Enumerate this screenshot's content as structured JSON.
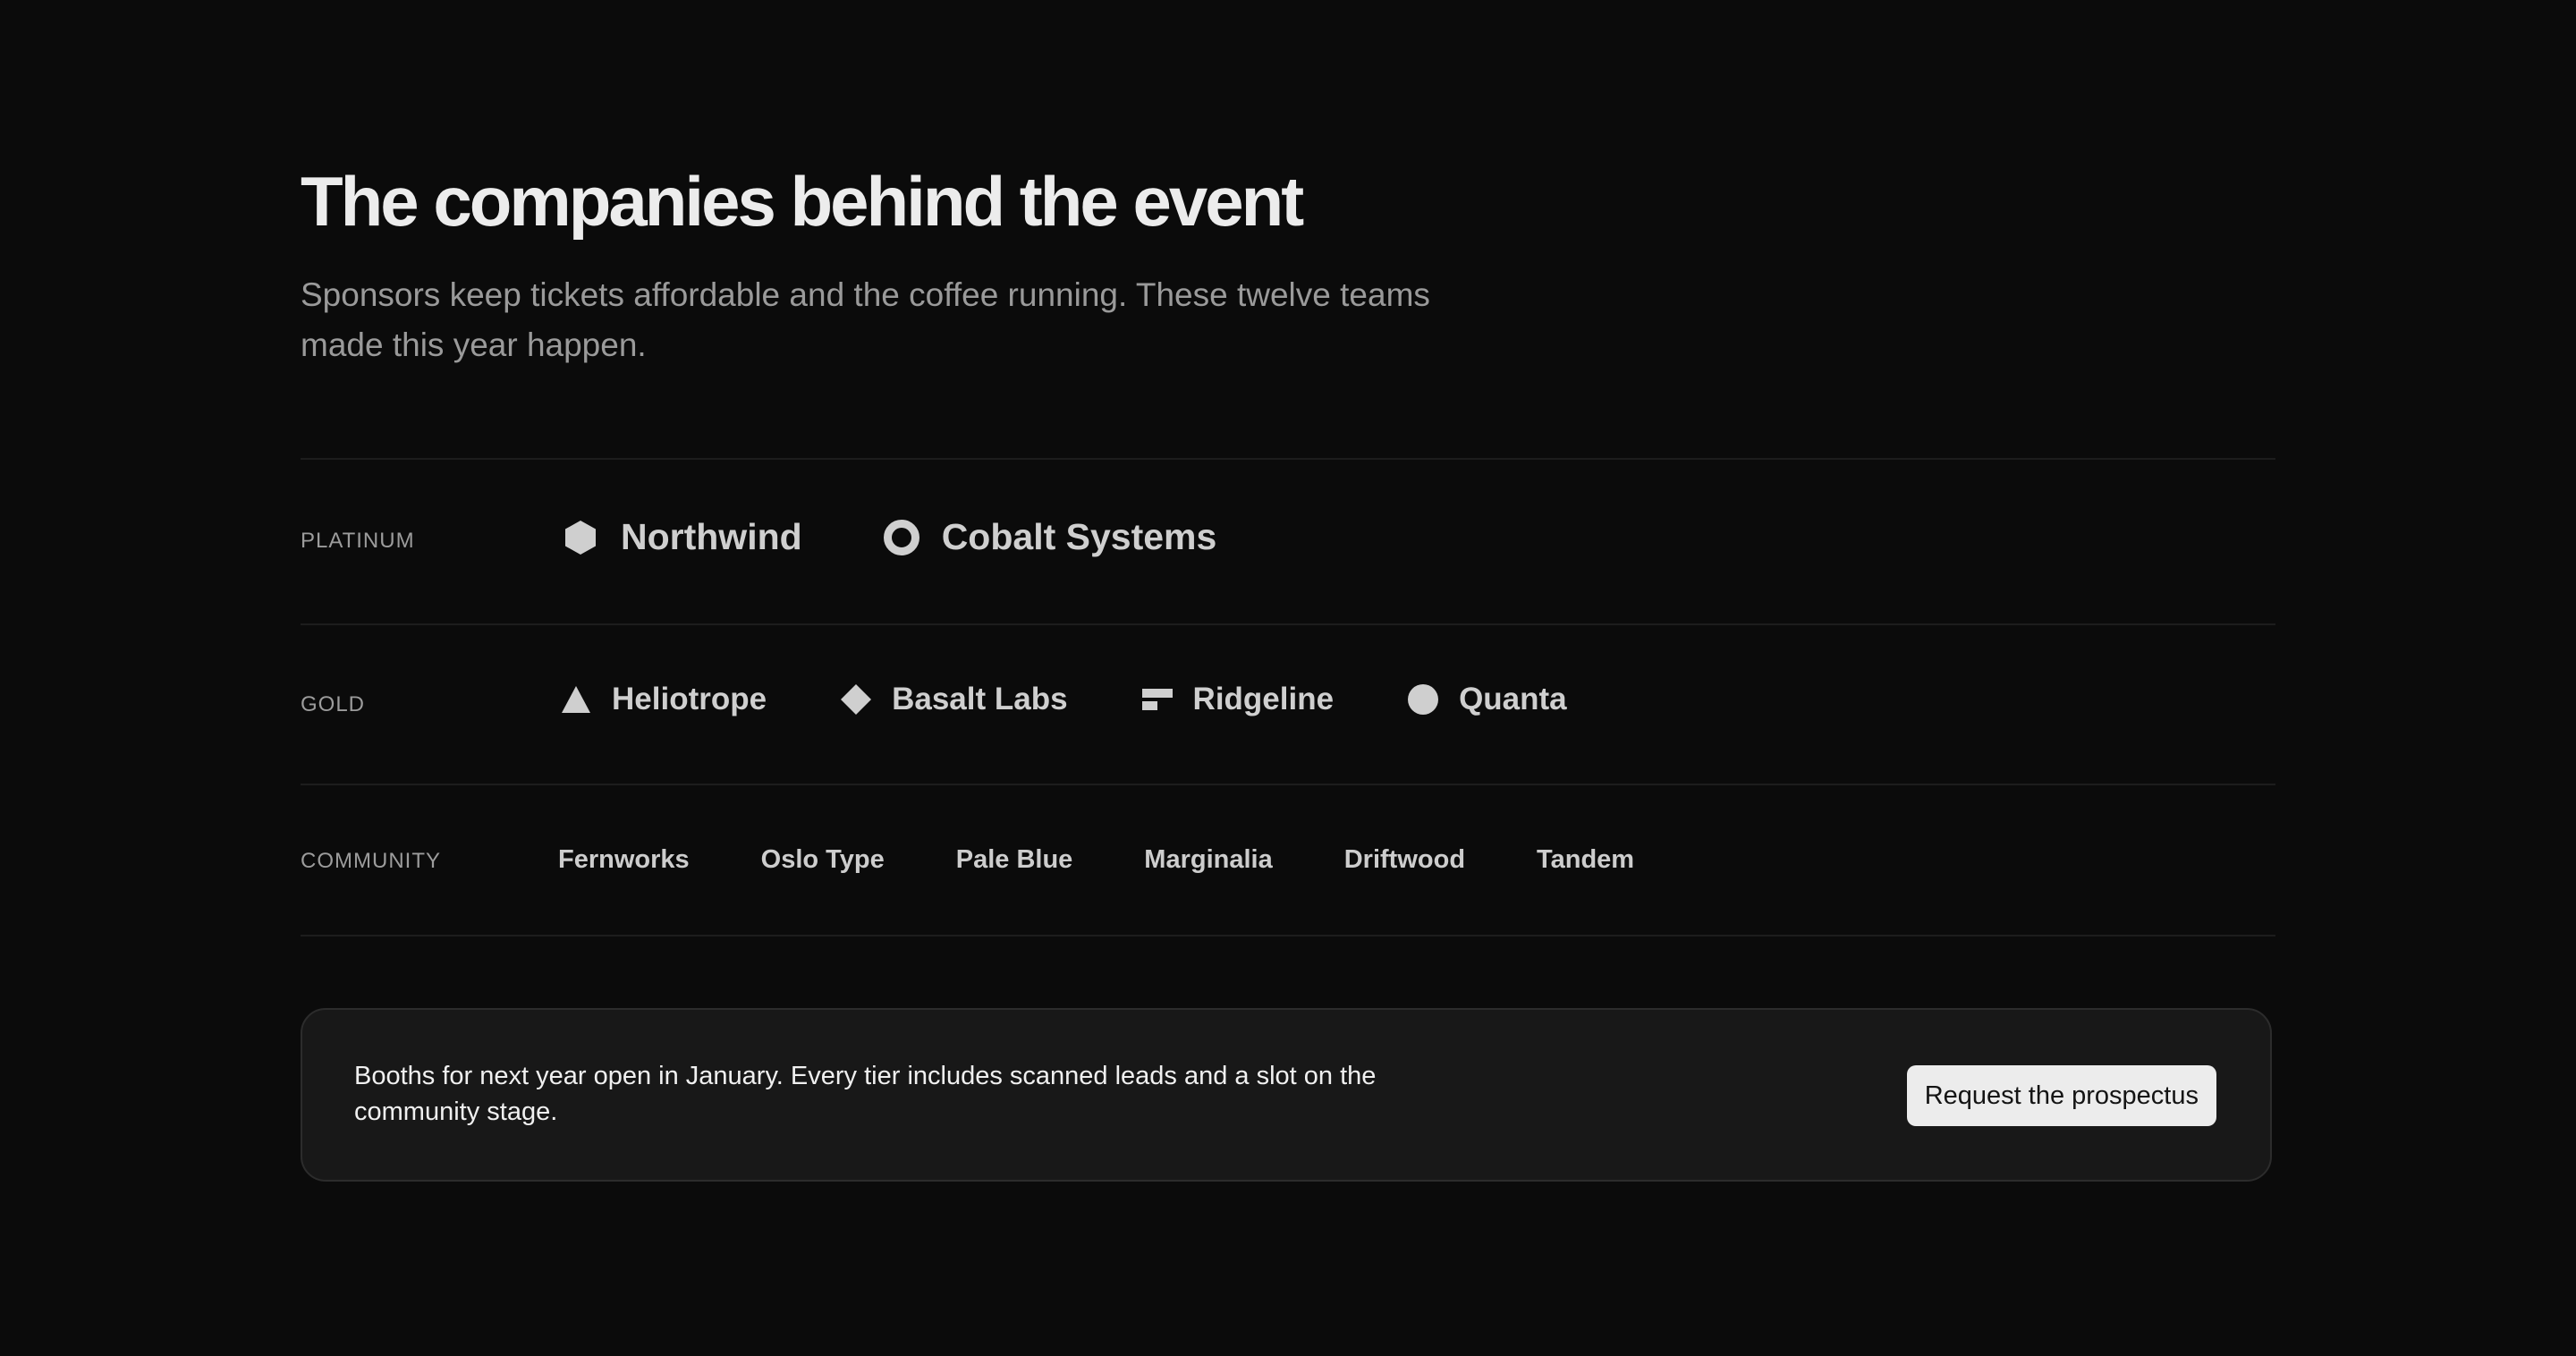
{
  "header": {
    "title": "The companies behind the event",
    "subtitle": "Sponsors keep tickets affordable and the coffee running. These twelve teams made this year happen."
  },
  "tiers": {
    "platinum": {
      "label": "PLATINUM",
      "sponsors": [
        {
          "name": "Northwind",
          "icon": "hexagon-icon"
        },
        {
          "name": "Cobalt Systems",
          "icon": "ring-icon"
        }
      ]
    },
    "gold": {
      "label": "GOLD",
      "sponsors": [
        {
          "name": "Heliotrope",
          "icon": "triangle-icon"
        },
        {
          "name": "Basalt Labs",
          "icon": "diamond-icon"
        },
        {
          "name": "Ridgeline",
          "icon": "bars-icon"
        },
        {
          "name": "Quanta",
          "icon": "circle-icon"
        }
      ]
    },
    "community": {
      "label": "COMMUNITY",
      "sponsors": [
        {
          "name": "Fernworks"
        },
        {
          "name": "Oslo Type"
        },
        {
          "name": "Pale Blue"
        },
        {
          "name": "Marginalia"
        },
        {
          "name": "Driftwood"
        },
        {
          "name": "Tandem"
        }
      ]
    }
  },
  "cta": {
    "text": "Booths for next year open in January. Every tier includes scanned leads and a slot on the community stage.",
    "button_label": "Request the prospectus"
  },
  "colors": {
    "background": "#0b0b0b",
    "panel": "#181818",
    "logo": "#cfcfcf",
    "muted": "#9a9a9a"
  }
}
